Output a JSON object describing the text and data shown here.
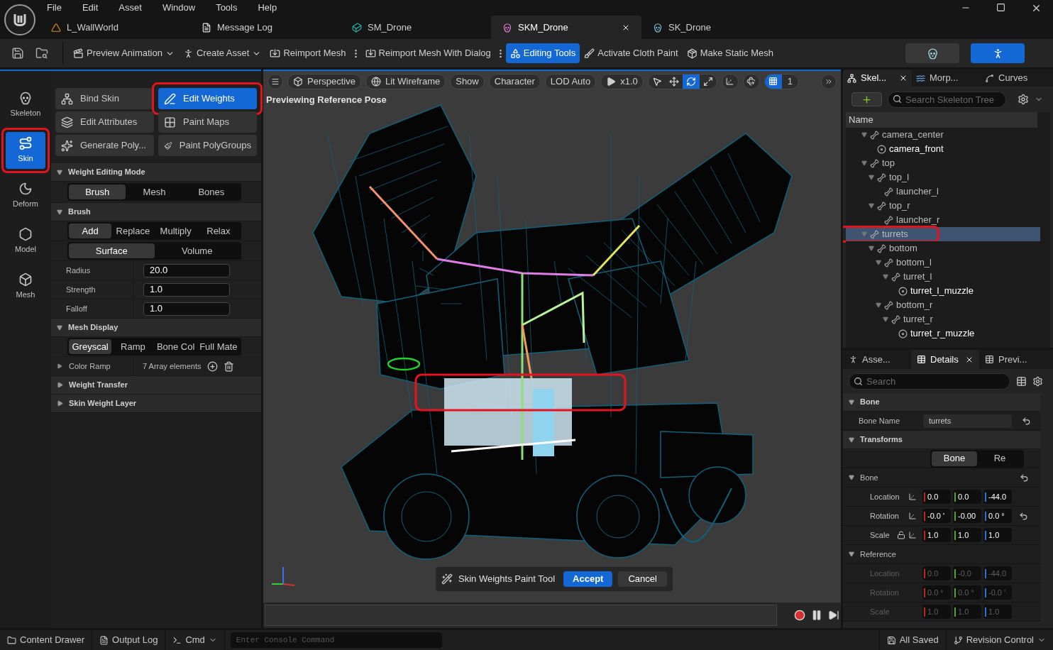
{
  "menu": [
    "File",
    "Edit",
    "Asset",
    "Window",
    "Tools",
    "Help"
  ],
  "doc_tabs": [
    {
      "label": "L_WallWorld",
      "kind": "level",
      "selected": false
    },
    {
      "label": "Message Log",
      "kind": "log",
      "selected": false
    },
    {
      "label": "SM_Drone",
      "kind": "static_mesh",
      "selected": false
    },
    {
      "label": "SKM_Drone",
      "kind": "skeletal_mesh",
      "selected": true
    },
    {
      "label": "SK_Drone",
      "kind": "skeleton",
      "selected": false
    }
  ],
  "toolbar": [
    {
      "label": "Preview Animation",
      "kind": "animation",
      "dropdown": true,
      "selected": false
    },
    {
      "label": "Create Asset",
      "kind": "create",
      "dropdown": true,
      "selected": false
    },
    {
      "label": "Reimport Mesh",
      "kind": "reimport",
      "dropdown": false,
      "selected": false
    },
    {
      "label": "Reimport Mesh With Dialog",
      "kind": "reimport",
      "dropdown": false,
      "selected": false
    },
    {
      "label": "Editing Tools",
      "kind": "editing",
      "dropdown": false,
      "selected": true
    },
    {
      "label": "Activate Cloth Paint",
      "kind": "paint",
      "dropdown": false,
      "selected": false
    },
    {
      "label": "Make Static Mesh",
      "kind": "static",
      "dropdown": false,
      "selected": false
    }
  ],
  "mode_switch": [
    {
      "kind": "skeleton",
      "selected": false
    },
    {
      "kind": "mesh",
      "selected": true
    }
  ],
  "mode_rail": [
    {
      "label": "Skeleton",
      "kind": "skeleton",
      "selected": false,
      "annotated": false
    },
    {
      "label": "Skin",
      "kind": "skin",
      "selected": true,
      "annotated": true
    },
    {
      "label": "Deform",
      "kind": "deform",
      "selected": false,
      "annotated": false
    },
    {
      "label": "Model",
      "kind": "model",
      "selected": false,
      "annotated": false
    },
    {
      "label": "Mesh",
      "kind": "mesh",
      "selected": false,
      "annotated": false
    }
  ],
  "tools": [
    {
      "label": "Bind Skin",
      "kind": "bind",
      "selected": false,
      "annotated": false
    },
    {
      "label": "Edit Weights",
      "kind": "weights",
      "selected": true,
      "annotated": true
    },
    {
      "label": "Edit Attributes",
      "kind": "attributes",
      "selected": false,
      "annotated": false
    },
    {
      "label": "Paint Maps",
      "kind": "maps",
      "selected": false,
      "annotated": false
    },
    {
      "label": "Generate Poly...",
      "kind": "generate",
      "selected": false,
      "annotated": false
    },
    {
      "label": "Paint PolyGroups",
      "kind": "polygroups",
      "selected": false,
      "annotated": false
    }
  ],
  "weight_editing_mode": {
    "title": "Weight Editing Mode",
    "options": [
      {
        "label": "Brush",
        "selected": true
      },
      {
        "label": "Mesh",
        "selected": false
      },
      {
        "label": "Bones",
        "selected": false
      }
    ]
  },
  "brush": {
    "title": "Brush",
    "operations": [
      {
        "label": "Add",
        "selected": true
      },
      {
        "label": "Replace",
        "selected": false
      },
      {
        "label": "Multiply",
        "selected": false
      },
      {
        "label": "Relax",
        "selected": false
      }
    ],
    "space": [
      {
        "label": "Surface",
        "selected": true
      },
      {
        "label": "Volume",
        "selected": false
      }
    ],
    "fields": [
      {
        "label": "Radius",
        "value": "20.0"
      },
      {
        "label": "Strength",
        "value": "1.0"
      },
      {
        "label": "Falloff",
        "value": "1.0"
      }
    ]
  },
  "mesh_display": {
    "title": "Mesh Display",
    "options": [
      {
        "label": "Greyscal",
        "selected": true
      },
      {
        "label": "Ramp",
        "selected": false
      },
      {
        "label": "Bone Col",
        "selected": false
      },
      {
        "label": "Full Mate",
        "selected": false
      }
    ],
    "color_ramp": {
      "label": "Color Ramp",
      "value": "7 Array elements"
    }
  },
  "collapsed_sections": [
    "Weight Transfer",
    "Skin Weight Layer"
  ],
  "viewport": {
    "toolbar": [
      {
        "label": "Perspective",
        "kind": "perspective"
      },
      {
        "label": "Lit Wireframe",
        "kind": "view_mode"
      },
      {
        "label": "Show",
        "kind": "plain"
      },
      {
        "label": "Character",
        "kind": "plain"
      },
      {
        "label": "LOD Auto",
        "kind": "plain"
      },
      {
        "label": "x1.0",
        "kind": "speed"
      }
    ],
    "transform_tools": [
      {
        "kind": "select",
        "selected": false
      },
      {
        "kind": "move",
        "selected": false
      },
      {
        "kind": "rotate",
        "selected": true
      },
      {
        "kind": "scale",
        "selected": false
      }
    ],
    "grid_snap": {
      "selected": true,
      "value": "1"
    },
    "status": "Previewing Reference Pose",
    "tool_overlay": {
      "title": "Skin Weights Paint Tool",
      "accept": "Accept",
      "cancel": "Cancel"
    }
  },
  "skeleton_panel": {
    "tabs": [
      {
        "label": "Skel...",
        "kind": "skeleton",
        "selected": true
      },
      {
        "label": "Morp...",
        "kind": "morph",
        "selected": false
      },
      {
        "label": "Curves",
        "kind": "curves",
        "selected": false
      }
    ],
    "search_placeholder": "Search Skeleton Tree",
    "column": "Name",
    "tree": [
      {
        "label": "camera_center",
        "kind": "bone",
        "selected": false,
        "annotated": false,
        "children": [
          {
            "label": "camera_front",
            "kind": "socket",
            "selected": false,
            "annotated": false
          }
        ]
      },
      {
        "label": "top",
        "kind": "bone",
        "selected": false,
        "annotated": false,
        "children": [
          {
            "label": "top_l",
            "kind": "bone",
            "selected": false,
            "annotated": false,
            "children": [
              {
                "label": "launcher_l",
                "kind": "bone",
                "selected": false,
                "annotated": false
              }
            ]
          },
          {
            "label": "top_r",
            "kind": "bone",
            "selected": false,
            "annotated": false,
            "children": [
              {
                "label": "launcher_r",
                "kind": "bone",
                "selected": false,
                "annotated": false
              }
            ]
          }
        ]
      },
      {
        "label": "turrets",
        "kind": "bone",
        "selected": true,
        "annotated": true,
        "children": [
          {
            "label": "bottom",
            "kind": "bone",
            "selected": false,
            "annotated": false,
            "children": [
              {
                "label": "bottom_l",
                "kind": "bone",
                "selected": false,
                "annotated": false,
                "children": [
                  {
                    "label": "turret_l",
                    "kind": "bone",
                    "selected": false,
                    "annotated": false,
                    "children": [
                      {
                        "label": "turret_l_muzzle",
                        "kind": "socket",
                        "selected": false,
                        "annotated": false
                      }
                    ]
                  }
                ]
              },
              {
                "label": "bottom_r",
                "kind": "bone",
                "selected": false,
                "annotated": false,
                "children": [
                  {
                    "label": "turret_r",
                    "kind": "bone",
                    "selected": false,
                    "annotated": false,
                    "children": [
                      {
                        "label": "turret_r_muzzle",
                        "kind": "socket",
                        "selected": false,
                        "annotated": false
                      }
                    ]
                  }
                ]
              }
            ]
          }
        ]
      }
    ]
  },
  "details_panel": {
    "tabs": [
      {
        "label": "Asse...",
        "kind": "asset",
        "selected": false
      },
      {
        "label": "Details",
        "kind": "details",
        "selected": true
      },
      {
        "label": "Previ...",
        "kind": "details",
        "selected": false
      }
    ],
    "search_placeholder": "Search",
    "bone_section": {
      "title": "Bone",
      "label": "Bone Name",
      "value": "turrets"
    },
    "transforms_title": "Transforms",
    "space_options": [
      {
        "label": "Bone",
        "selected": true
      },
      {
        "label": "Re",
        "selected": false
      }
    ],
    "groups": [
      {
        "title": "Bone",
        "disabled": false,
        "rows": [
          {
            "label": "Location",
            "values": [
              "0.0",
              "0.0",
              "-44.0"
            ],
            "reset": false,
            "lock": false
          },
          {
            "label": "Rotation",
            "values": [
              "-0.0 '",
              "-0.00",
              "0.0 °"
            ],
            "reset": true,
            "lock": false
          },
          {
            "label": "Scale",
            "values": [
              "1.0",
              "1.0",
              "1.0"
            ],
            "reset": false,
            "lock": true
          }
        ]
      },
      {
        "title": "Reference",
        "disabled": true,
        "rows": [
          {
            "label": "Location",
            "values": [
              "0.0",
              "-0.0",
              "-44.0"
            ],
            "reset": false,
            "lock": false
          },
          {
            "label": "Rotation",
            "values": [
              "0.0 °",
              "0.0 °",
              "-0.0 '"
            ],
            "reset": false,
            "lock": false
          },
          {
            "label": "Scale",
            "values": [
              "1.0",
              "1.0",
              "1.0"
            ],
            "reset": false,
            "lock": false
          }
        ]
      }
    ]
  },
  "status_bar": {
    "left": [
      {
        "label": "Content Drawer",
        "kind": "drawer",
        "dropdown": false
      },
      {
        "label": "Output Log",
        "kind": "log",
        "dropdown": false
      },
      {
        "label": "Cmd",
        "kind": "cmd",
        "dropdown": true
      }
    ],
    "console_placeholder": "Enter Console Command",
    "right": [
      {
        "label": "All Saved",
        "kind": "saved",
        "dropdown": false
      },
      {
        "label": "Revision Control",
        "kind": "revision",
        "dropdown": true
      }
    ]
  }
}
